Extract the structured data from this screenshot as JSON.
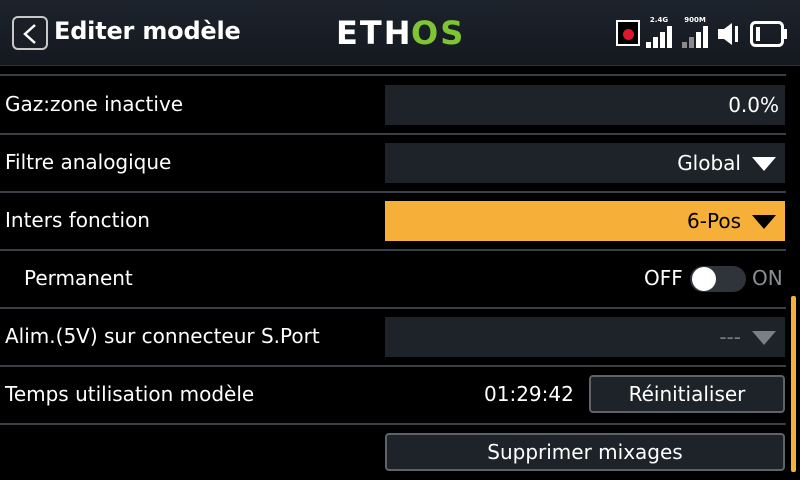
{
  "header": {
    "title": "Editer modèle",
    "logo": {
      "text_a": "ETH",
      "text_b": "OS",
      "color_a": "#ffffff",
      "color_b": "#7ec531"
    },
    "status": {
      "recording": true,
      "signal_2g4": {
        "band": "2.4G",
        "bars": 4
      },
      "signal_900m": {
        "band": "900M",
        "bars": 4
      },
      "speaker_icon": "speaker-icon",
      "battery_icon": "battery-icon"
    }
  },
  "rows": {
    "throttle_deadzone": {
      "label": "Gaz:zone inactive",
      "value": "0.0%"
    },
    "analog_filter": {
      "label": "Filtre analogique",
      "value": "Global"
    },
    "function_switches": {
      "label": "Inters fonction",
      "value": "6-Pos"
    },
    "permanent": {
      "label": "Permanent",
      "off_label": "OFF",
      "on_label": "ON",
      "state": "off"
    },
    "sport_power": {
      "label": "Alim.(5V) sur connecteur S.Port",
      "value": "---"
    },
    "model_time": {
      "label": "Temps utilisation modèle",
      "value": "01:29:42",
      "reset_label": "Réinitialiser"
    },
    "delete_mixes": {
      "label": "Supprimer mixages"
    }
  },
  "colors": {
    "accent": "#f6af38",
    "field_bg": "#1e2329",
    "background": "#000000"
  }
}
